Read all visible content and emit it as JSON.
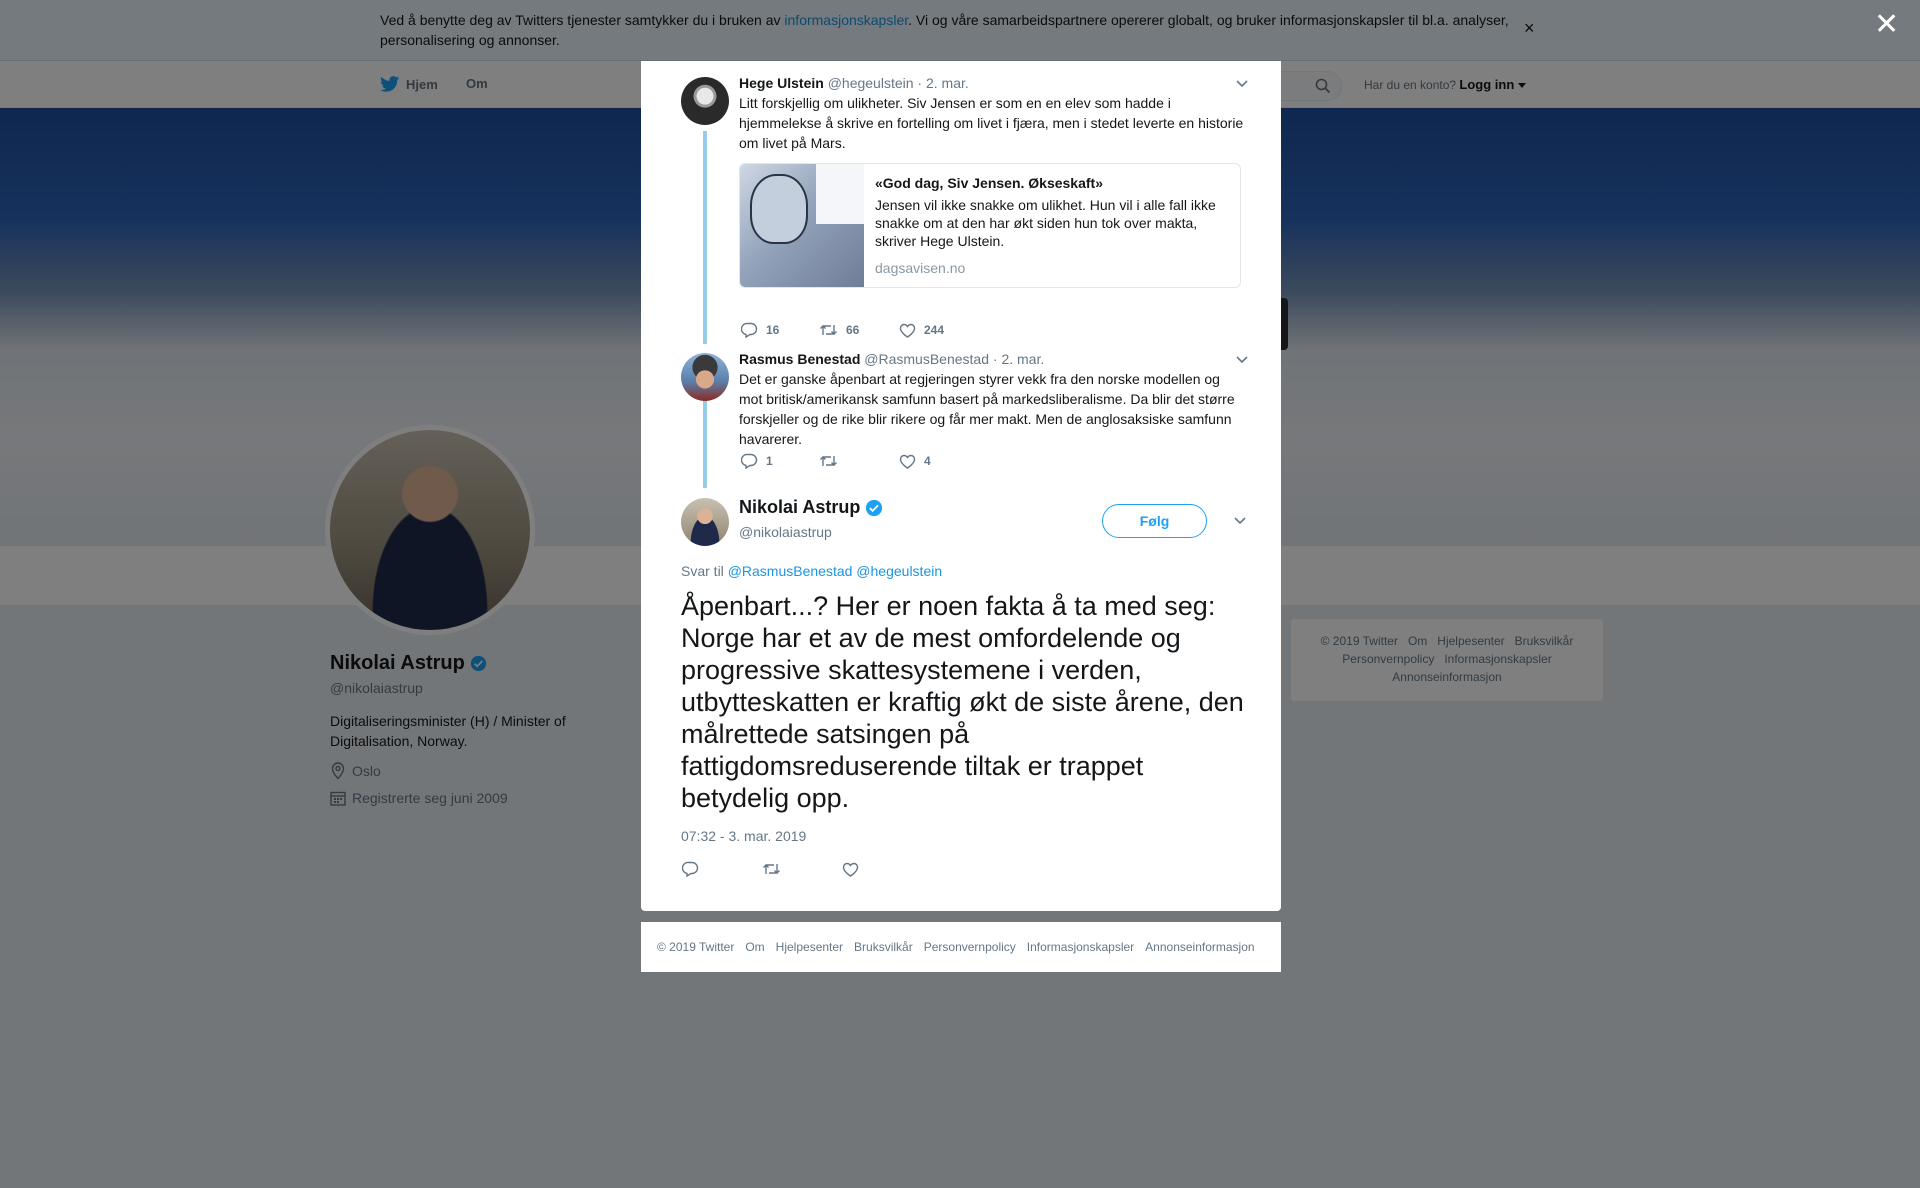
{
  "cookie_bar": {
    "text_before": "Ved å benytte deg av Twitters tjenester samtykker du i bruken av ",
    "link": "informasjonskapsler",
    "text_after": ". Vi og våre samarbeidspartnere opererer globalt, og bruker informasjonskapsler til bl.a. analyser, personalisering og annonser.",
    "close": "×"
  },
  "topnav": {
    "home": "Hjem",
    "about": "Om",
    "account_prompt": "Har du en konto?",
    "login": "Logg inn"
  },
  "profile": {
    "name": "Nikolai Astrup",
    "handle": "@nikolaiastrup",
    "bio": "Digitaliseringsminister (H) / Minister of Digitalisation, Norway.",
    "location": "Oslo",
    "joined": "Registrerte seg juni 2009"
  },
  "side_footer": {
    "items": [
      "© 2019 Twitter",
      "Om",
      "Hjelpesenter",
      "Bruksvilkår",
      "Personvernpolicy",
      "Informasjonskapsler",
      "Annonseinformasjon"
    ]
  },
  "overlay_close": "✕",
  "thread": [
    {
      "name": "Hege Ulstein",
      "handle": "@hegeulstein",
      "date": "· 2. mar.",
      "text": "Litt forskjellig om ulikheter.  Siv Jensen er som en en elev som hadde i hjemmelekse å skrive en fortelling om livet i fjæra, men i stedet leverte en historie om livet på Mars.",
      "card": {
        "title": "«God dag, Siv Jensen. Økseskaft»",
        "description": "Jensen vil ikke snakke om ulikhet. Hun vil i alle fall ikke snakke om at den har økt siden hun tok over makta, skriver Hege Ulstein.",
        "domain": "dagsavisen.no"
      },
      "replies": "16",
      "retweets": "66",
      "likes": "244"
    },
    {
      "name": "Rasmus Benestad",
      "handle": "@RasmusBenestad",
      "date": "· 2. mar.",
      "text": "Det er ganske åpenbart at regjeringen styrer vekk fra den norske modellen og mot britisk/amerikansk samfunn basert på markedsliberalisme. Da blir det større forskjeller og de rike blir rikere og får mer makt. Men de anglosaksiske samfunn havarerer.",
      "replies": "1",
      "retweets": "",
      "likes": "4"
    }
  ],
  "main_tweet": {
    "name": "Nikolai Astrup",
    "handle": "@nikolaiastrup",
    "follow": "Følg",
    "reply_prefix": "Svar til ",
    "mention1": "@RasmusBenestad",
    "mention2": "@hegeulstein",
    "text": "Åpenbart...? Her er noen fakta å ta med seg: Norge har et av de mest omfordelende og progressive skattesystemene i verden, utbytteskatten er kraftig økt de siste årene, den målrettede satsingen på fattigdomsreduserende tiltak er trappet betydelig opp.",
    "timestamp": "07:32 - 3. mar. 2019"
  },
  "modal_footer": {
    "items": [
      "© 2019 Twitter",
      "Om",
      "Hjelpesenter",
      "Bruksvilkår",
      "Personvernpolicy",
      "Informasjonskapsler",
      "Annonseinformasjon"
    ]
  },
  "colors": {
    "twitter_blue": "#1da1f2",
    "link_blue": "#1b95e0",
    "thread_line": "#95cde8",
    "verified": "#1da1f2"
  },
  "icons": [
    "twitter-bird-icon",
    "search-icon",
    "caret-down-icon",
    "reply-icon",
    "retweet-icon",
    "heart-icon",
    "verified-badge-icon",
    "location-icon",
    "calendar-icon",
    "close-icon"
  ]
}
